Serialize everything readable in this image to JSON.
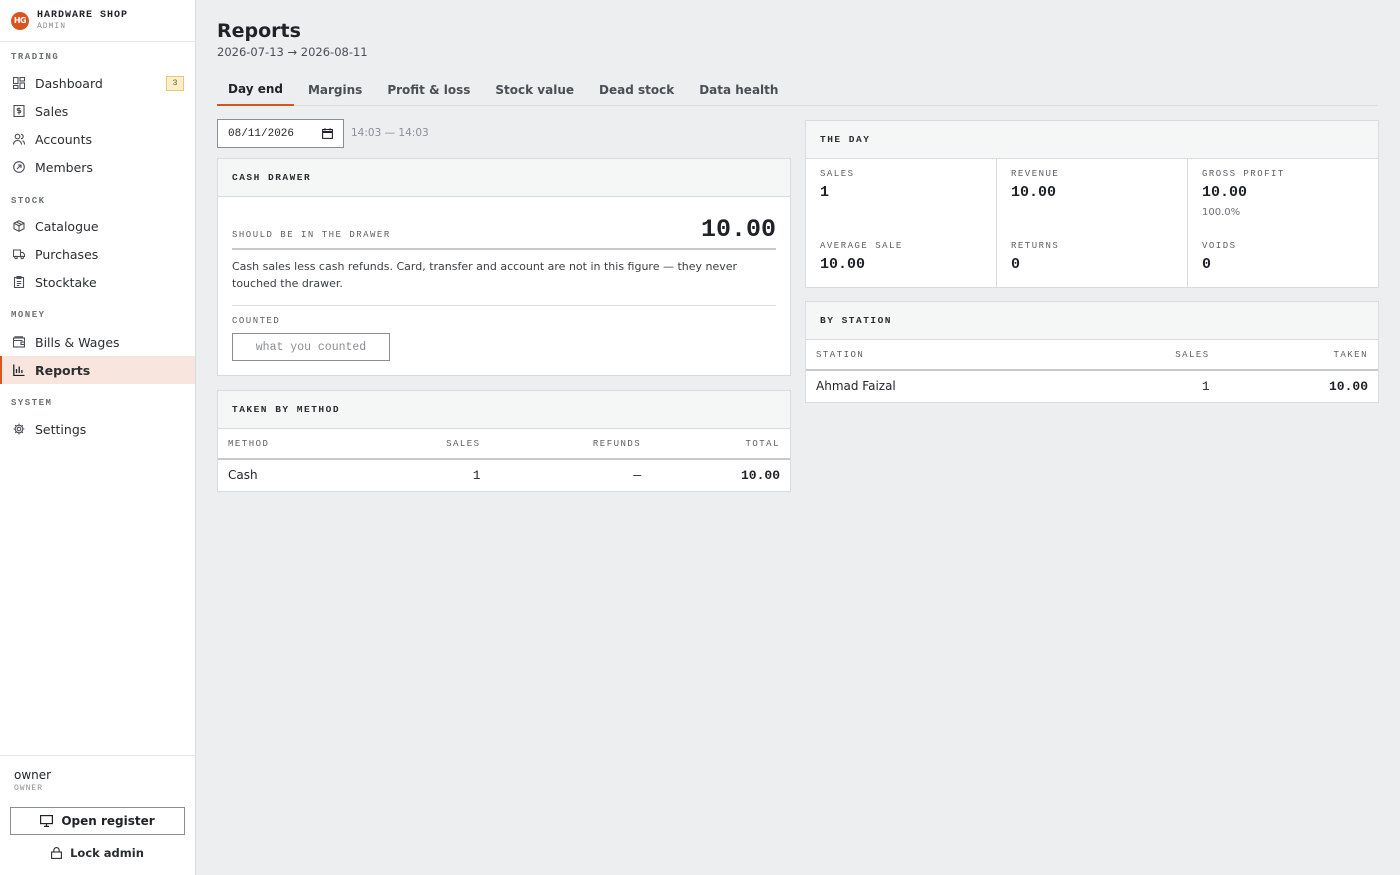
{
  "brand": {
    "logo_text": "HG",
    "name": "HARDWARE SHOP",
    "subtitle": "ADMIN"
  },
  "nav": {
    "sections": [
      {
        "label": "TRADING",
        "items": [
          {
            "label": "Dashboard",
            "icon": "dashboard-icon",
            "badge": "3"
          },
          {
            "label": "Sales",
            "icon": "receipt-icon"
          },
          {
            "label": "Accounts",
            "icon": "users-icon"
          },
          {
            "label": "Members",
            "icon": "badge-icon"
          }
        ]
      },
      {
        "label": "STOCK",
        "items": [
          {
            "label": "Catalogue",
            "icon": "box-icon"
          },
          {
            "label": "Purchases",
            "icon": "truck-icon"
          },
          {
            "label": "Stocktake",
            "icon": "clipboard-icon"
          }
        ]
      },
      {
        "label": "MONEY",
        "items": [
          {
            "label": "Bills & Wages",
            "icon": "wallet-icon"
          },
          {
            "label": "Reports",
            "icon": "bar-chart-icon",
            "active": true
          }
        ]
      },
      {
        "label": "SYSTEM",
        "items": [
          {
            "label": "Settings",
            "icon": "gear-icon"
          }
        ]
      }
    ]
  },
  "user": {
    "name": "owner",
    "role": "OWNER",
    "open_register": "Open register",
    "lock": "Lock admin"
  },
  "page": {
    "title": "Reports",
    "range": "2026-07-13 → 2026-08-11"
  },
  "tabs": [
    "Day end",
    "Margins",
    "Profit & loss",
    "Stock value",
    "Dead stock",
    "Data health"
  ],
  "active_tab": "Day end",
  "filter": {
    "date": "08/11/2026",
    "time_range": "14:03 — 14:03"
  },
  "cash_drawer": {
    "title": "CASH DRAWER",
    "should_label": "SHOULD BE IN THE DRAWER",
    "amount": "10.00",
    "note": "Cash sales less cash refunds. Card, transfer and account are not in this figure — they never touched the drawer.",
    "counted_label": "COUNTED",
    "counted_placeholder": "what you counted"
  },
  "taken_by_method": {
    "title": "TAKEN BY METHOD",
    "columns": [
      "METHOD",
      "SALES",
      "REFUNDS",
      "TOTAL"
    ],
    "rows": [
      {
        "method": "Cash",
        "sales": "1",
        "refunds": "—",
        "total": "10.00"
      }
    ]
  },
  "the_day": {
    "title": "THE DAY",
    "stats": [
      {
        "label": "SALES",
        "value": "1"
      },
      {
        "label": "REVENUE",
        "value": "10.00"
      },
      {
        "label": "GROSS PROFIT",
        "value": "10.00",
        "sub": "100.0%"
      },
      {
        "label": "AVERAGE SALE",
        "value": "10.00"
      },
      {
        "label": "RETURNS",
        "value": "0"
      },
      {
        "label": "VOIDS",
        "value": "0"
      }
    ]
  },
  "by_station": {
    "title": "BY STATION",
    "columns": [
      "STATION",
      "SALES",
      "TAKEN"
    ],
    "rows": [
      {
        "station": "Ahmad Faizal",
        "sales": "1",
        "taken": "10.00"
      }
    ]
  },
  "colors": {
    "accent": "#d9541e",
    "active_bg": "#f8e5dd",
    "page_bg": "#eceef0"
  }
}
